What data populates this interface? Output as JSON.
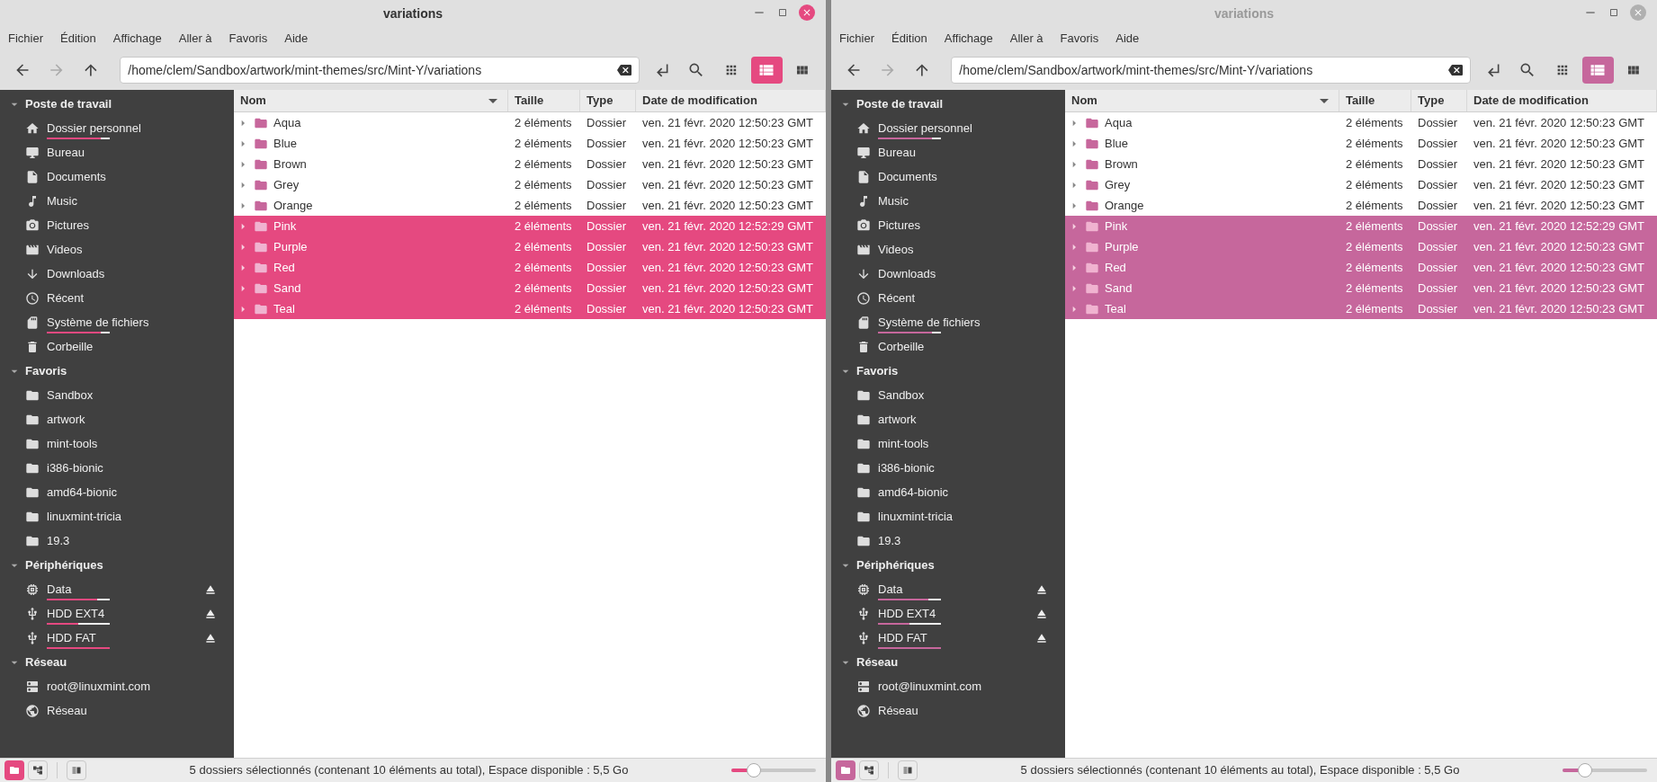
{
  "windows": [
    {
      "title": "variations",
      "focused": true,
      "color": "#e54980",
      "menu": [
        "Fichier",
        "Édition",
        "Affichage",
        "Aller à",
        "Favoris",
        "Aide"
      ],
      "path": "/home/clem/Sandbox/artwork/mint-themes/src/Mint-Y/variations",
      "sidebar": [
        {
          "title": "Poste de travail",
          "expanded": true,
          "items": [
            {
              "label": "Dossier personnel",
              "kind": "home",
              "level": 0.85
            },
            {
              "label": "Bureau",
              "kind": "desktop"
            },
            {
              "label": "Documents",
              "kind": "document"
            },
            {
              "label": "Music",
              "kind": "music"
            },
            {
              "label": "Pictures",
              "kind": "camera"
            },
            {
              "label": "Videos",
              "kind": "film"
            },
            {
              "label": "Downloads",
              "kind": "download"
            },
            {
              "label": "Récent",
              "kind": "clock"
            },
            {
              "label": "Système de fichiers",
              "kind": "drive",
              "level": 0.85
            },
            {
              "label": "Corbeille",
              "kind": "trash"
            }
          ]
        },
        {
          "title": "Favoris",
          "expanded": true,
          "items": [
            {
              "label": "Sandbox",
              "kind": "folder"
            },
            {
              "label": "artwork",
              "kind": "folder"
            },
            {
              "label": "mint-tools",
              "kind": "folder"
            },
            {
              "label": "i386-bionic",
              "kind": "folder"
            },
            {
              "label": "amd64-bionic",
              "kind": "folder"
            },
            {
              "label": "linuxmint-tricia",
              "kind": "folder"
            },
            {
              "label": "19.3",
              "kind": "folder"
            }
          ]
        },
        {
          "title": "Périphériques",
          "expanded": true,
          "items": [
            {
              "label": "Data",
              "kind": "chip",
              "level": 0.8,
              "eject": true
            },
            {
              "label": "HDD EXT4",
              "kind": "usb",
              "level": 0.5,
              "eject": true
            },
            {
              "label": "HDD FAT",
              "kind": "usb",
              "level": 1.0,
              "eject": true
            }
          ]
        },
        {
          "title": "Réseau",
          "expanded": true,
          "items": [
            {
              "label": "root@linuxmint.com",
              "kind": "server"
            },
            {
              "label": "Réseau",
              "kind": "globe"
            }
          ]
        }
      ],
      "columns": [
        "Nom",
        "Taille",
        "Type",
        "Date de modification"
      ],
      "rows": [
        {
          "name": "Aqua",
          "size": "2 éléments",
          "type": "Dossier",
          "date": "ven. 21 févr. 2020 12:50:23 GMT",
          "selected": false
        },
        {
          "name": "Blue",
          "size": "2 éléments",
          "type": "Dossier",
          "date": "ven. 21 févr. 2020 12:50:23 GMT",
          "selected": false
        },
        {
          "name": "Brown",
          "size": "2 éléments",
          "type": "Dossier",
          "date": "ven. 21 févr. 2020 12:50:23 GMT",
          "selected": false
        },
        {
          "name": "Grey",
          "size": "2 éléments",
          "type": "Dossier",
          "date": "ven. 21 févr. 2020 12:50:23 GMT",
          "selected": false
        },
        {
          "name": "Orange",
          "size": "2 éléments",
          "type": "Dossier",
          "date": "ven. 21 févr. 2020 12:50:23 GMT",
          "selected": false
        },
        {
          "name": "Pink",
          "size": "2 éléments",
          "type": "Dossier",
          "date": "ven. 21 févr. 2020 12:52:29 GMT",
          "selected": true
        },
        {
          "name": "Purple",
          "size": "2 éléments",
          "type": "Dossier",
          "date": "ven. 21 févr. 2020 12:50:23 GMT",
          "selected": true
        },
        {
          "name": "Red",
          "size": "2 éléments",
          "type": "Dossier",
          "date": "ven. 21 févr. 2020 12:50:23 GMT",
          "selected": true
        },
        {
          "name": "Sand",
          "size": "2 éléments",
          "type": "Dossier",
          "date": "ven. 21 févr. 2020 12:50:23 GMT",
          "selected": true
        },
        {
          "name": "Teal",
          "size": "2 éléments",
          "type": "Dossier",
          "date": "ven. 21 févr. 2020 12:50:23 GMT",
          "selected": true
        }
      ],
      "status": "5 dossiers sélectionnés (contenant 10 éléments au total), Espace disponible : 5,5 Go",
      "zoom": {
        "level": 0.2
      }
    },
    {
      "title": "variations",
      "focused": false,
      "color": "#c6679c",
      "menu": [
        "Fichier",
        "Édition",
        "Affichage",
        "Aller à",
        "Favoris",
        "Aide"
      ],
      "path": "/home/clem/Sandbox/artwork/mint-themes/src/Mint-Y/variations",
      "sidebar": [
        {
          "title": "Poste de travail",
          "expanded": true,
          "items": [
            {
              "label": "Dossier personnel",
              "kind": "home",
              "level": 0.85
            },
            {
              "label": "Bureau",
              "kind": "desktop"
            },
            {
              "label": "Documents",
              "kind": "document"
            },
            {
              "label": "Music",
              "kind": "music"
            },
            {
              "label": "Pictures",
              "kind": "camera"
            },
            {
              "label": "Videos",
              "kind": "film"
            },
            {
              "label": "Downloads",
              "kind": "download"
            },
            {
              "label": "Récent",
              "kind": "clock"
            },
            {
              "label": "Système de fichiers",
              "kind": "drive",
              "level": 0.85
            },
            {
              "label": "Corbeille",
              "kind": "trash"
            }
          ]
        },
        {
          "title": "Favoris",
          "expanded": true,
          "items": [
            {
              "label": "Sandbox",
              "kind": "folder"
            },
            {
              "label": "artwork",
              "kind": "folder"
            },
            {
              "label": "mint-tools",
              "kind": "folder"
            },
            {
              "label": "i386-bionic",
              "kind": "folder"
            },
            {
              "label": "amd64-bionic",
              "kind": "folder"
            },
            {
              "label": "linuxmint-tricia",
              "kind": "folder"
            },
            {
              "label": "19.3",
              "kind": "folder"
            }
          ]
        },
        {
          "title": "Périphériques",
          "expanded": true,
          "items": [
            {
              "label": "Data",
              "kind": "chip",
              "level": 0.8,
              "eject": true
            },
            {
              "label": "HDD EXT4",
              "kind": "usb",
              "level": 0.5,
              "eject": true
            },
            {
              "label": "HDD FAT",
              "kind": "usb",
              "level": 1.0,
              "eject": true
            }
          ]
        },
        {
          "title": "Réseau",
          "expanded": true,
          "items": [
            {
              "label": "root@linuxmint.com",
              "kind": "server"
            },
            {
              "label": "Réseau",
              "kind": "globe"
            }
          ]
        }
      ],
      "columns": [
        "Nom",
        "Taille",
        "Type",
        "Date de modification"
      ],
      "rows": [
        {
          "name": "Aqua",
          "size": "2 éléments",
          "type": "Dossier",
          "date": "ven. 21 févr. 2020 12:50:23 GMT",
          "selected": false
        },
        {
          "name": "Blue",
          "size": "2 éléments",
          "type": "Dossier",
          "date": "ven. 21 févr. 2020 12:50:23 GMT",
          "selected": false
        },
        {
          "name": "Brown",
          "size": "2 éléments",
          "type": "Dossier",
          "date": "ven. 21 févr. 2020 12:50:23 GMT",
          "selected": false
        },
        {
          "name": "Grey",
          "size": "2 éléments",
          "type": "Dossier",
          "date": "ven. 21 févr. 2020 12:50:23 GMT",
          "selected": false
        },
        {
          "name": "Orange",
          "size": "2 éléments",
          "type": "Dossier",
          "date": "ven. 21 févr. 2020 12:50:23 GMT",
          "selected": false
        },
        {
          "name": "Pink",
          "size": "2 éléments",
          "type": "Dossier",
          "date": "ven. 21 févr. 2020 12:52:29 GMT",
          "selected": true
        },
        {
          "name": "Purple",
          "size": "2 éléments",
          "type": "Dossier",
          "date": "ven. 21 févr. 2020 12:50:23 GMT",
          "selected": true
        },
        {
          "name": "Red",
          "size": "2 éléments",
          "type": "Dossier",
          "date": "ven. 21 févr. 2020 12:50:23 GMT",
          "selected": true
        },
        {
          "name": "Sand",
          "size": "2 éléments",
          "type": "Dossier",
          "date": "ven. 21 févr. 2020 12:50:23 GMT",
          "selected": true
        },
        {
          "name": "Teal",
          "size": "2 éléments",
          "type": "Dossier",
          "date": "ven. 21 févr. 2020 12:50:23 GMT",
          "selected": true
        }
      ],
      "status": "5 dossiers sélectionnés (contenant 10 éléments au total), Espace disponible : 5,5 Go",
      "zoom": {
        "level": 0.2
      }
    }
  ]
}
